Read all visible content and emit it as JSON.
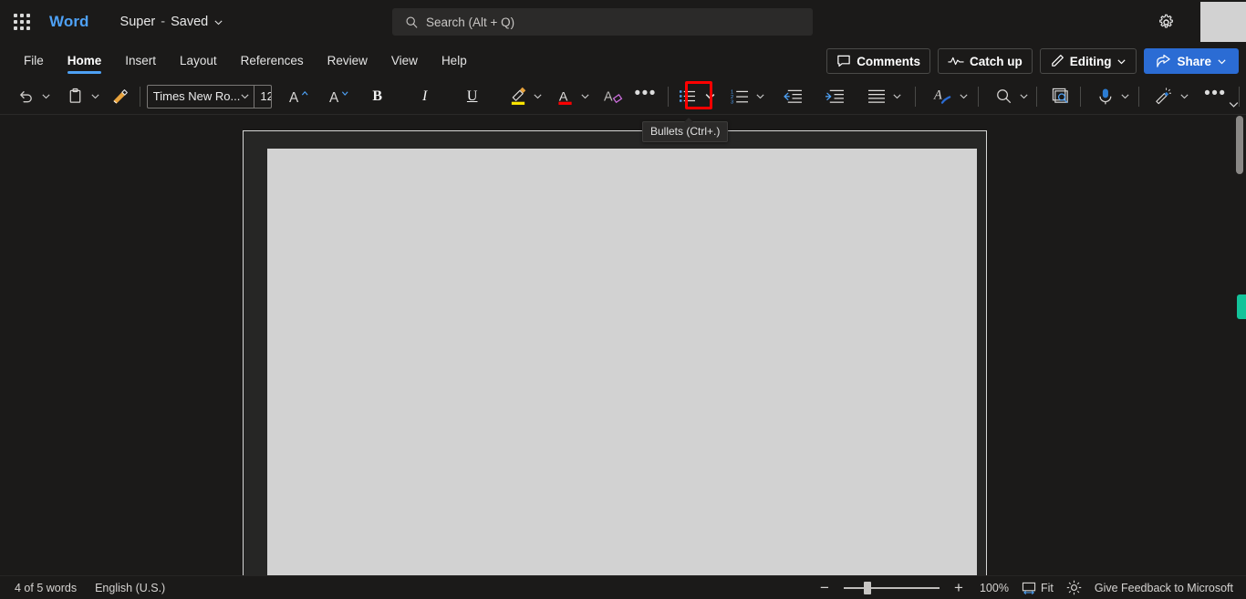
{
  "titlebar": {
    "app_launcher": "app-launcher",
    "brand": "Word",
    "document_name": "Super",
    "separator": "-",
    "save_state": "Saved",
    "settings_icon": "gear-icon"
  },
  "search": {
    "placeholder": "Search (Alt + Q)",
    "icon": "search-icon"
  },
  "ribbon": {
    "tabs": [
      {
        "label": "File",
        "active": false
      },
      {
        "label": "Home",
        "active": true
      },
      {
        "label": "Insert",
        "active": false
      },
      {
        "label": "Layout",
        "active": false
      },
      {
        "label": "References",
        "active": false
      },
      {
        "label": "Review",
        "active": false
      },
      {
        "label": "View",
        "active": false
      },
      {
        "label": "Help",
        "active": false
      }
    ],
    "actions": {
      "comments": "Comments",
      "catch_up": "Catch up",
      "editing": "Editing",
      "share": "Share"
    }
  },
  "toolbar": {
    "undo": "undo-icon",
    "paste": "paste-icon",
    "format_painter": "format-painter-icon",
    "font_name": "Times New Ro...",
    "font_size": "12",
    "grow_font": "grow-font-icon",
    "shrink_font": "shrink-font-icon",
    "bold": "B",
    "italic": "I",
    "underline": "U",
    "highlight": "text-highlight-icon",
    "font_color": "A",
    "clear_formatting": "clear-formatting-icon",
    "more_font_options": "•••",
    "bullets": "bullets-icon",
    "numbering": "numbering-icon",
    "decrease_indent": "decrease-indent-icon",
    "increase_indent": "increase-indent-icon",
    "alignment": "align-icon",
    "styles": "styles-icon",
    "find": "find-icon",
    "editor": "editor-icon",
    "dictate": "dictate-icon",
    "copilot": "copilot-icon",
    "more_options": "•••",
    "collapse_ribbon": "chevron-down-icon"
  },
  "tooltip": {
    "text": "Bullets (Ctrl+.)"
  },
  "document": {
    "page_label": "document-page"
  },
  "statusbar": {
    "word_count": "4 of 5 words",
    "language": "English (U.S.)",
    "zoom_out": "−",
    "zoom_in": "+",
    "zoom_level": "100%",
    "fit": "Fit",
    "focus": "focus-mode-icon",
    "feedback": "Give Feedback to Microsoft"
  },
  "colors": {
    "brand_blue": "#4ea1f5",
    "share_blue": "#2b6cd4",
    "highlight_red": "#ff0000",
    "scroll_flag_teal": "#13c39a",
    "window_bg": "#1b1a19",
    "page_bg": "#d2d2d2"
  }
}
